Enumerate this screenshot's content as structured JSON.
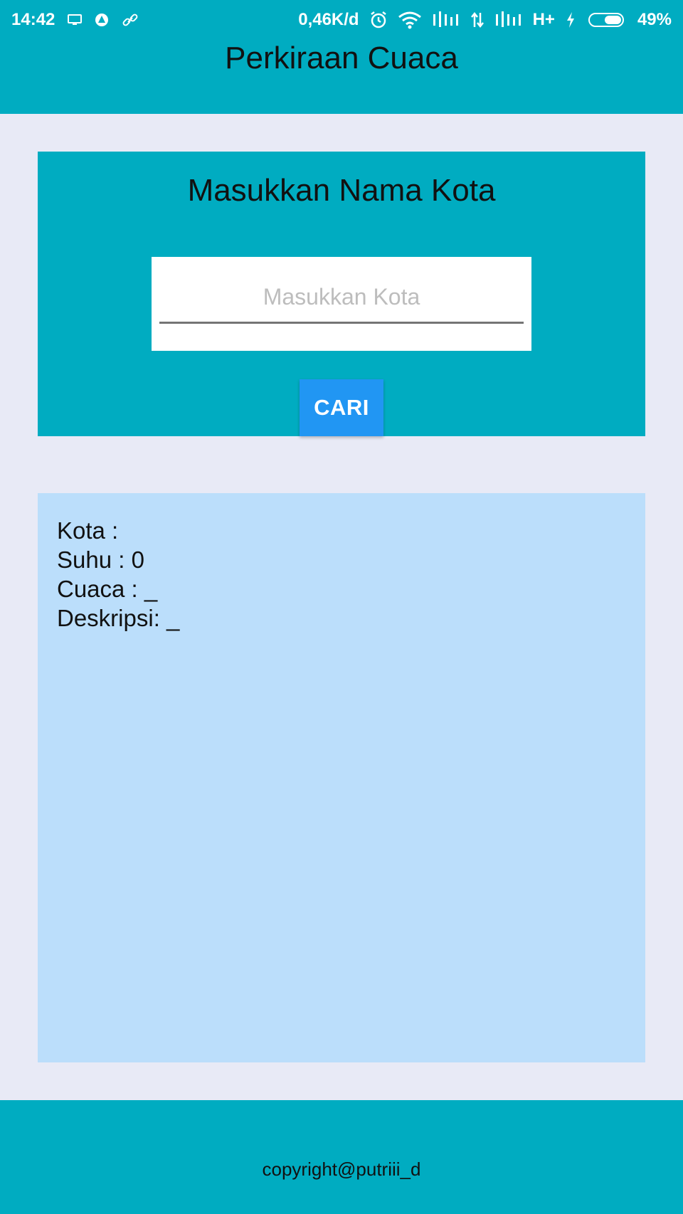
{
  "status_bar": {
    "time": "14:42",
    "speed": "0,46K/d",
    "network": "H+",
    "battery": "49%"
  },
  "header": {
    "title": "Perkiraan Cuaca"
  },
  "search": {
    "heading": "Masukkan Nama Kota",
    "placeholder": "Masukkan Kota",
    "value": "",
    "button_label": "CARI"
  },
  "result": {
    "city": "Kota : ",
    "temperature": "Suhu : 0",
    "weather": "Cuaca : _",
    "description": "Deskripsi: _"
  },
  "footer": {
    "copyright": "copyright@putriii_d"
  },
  "colors": {
    "primary": "#00acc1",
    "button": "#2196f3",
    "result_bg": "#bbdefb",
    "page_bg": "#e8eaf6"
  }
}
